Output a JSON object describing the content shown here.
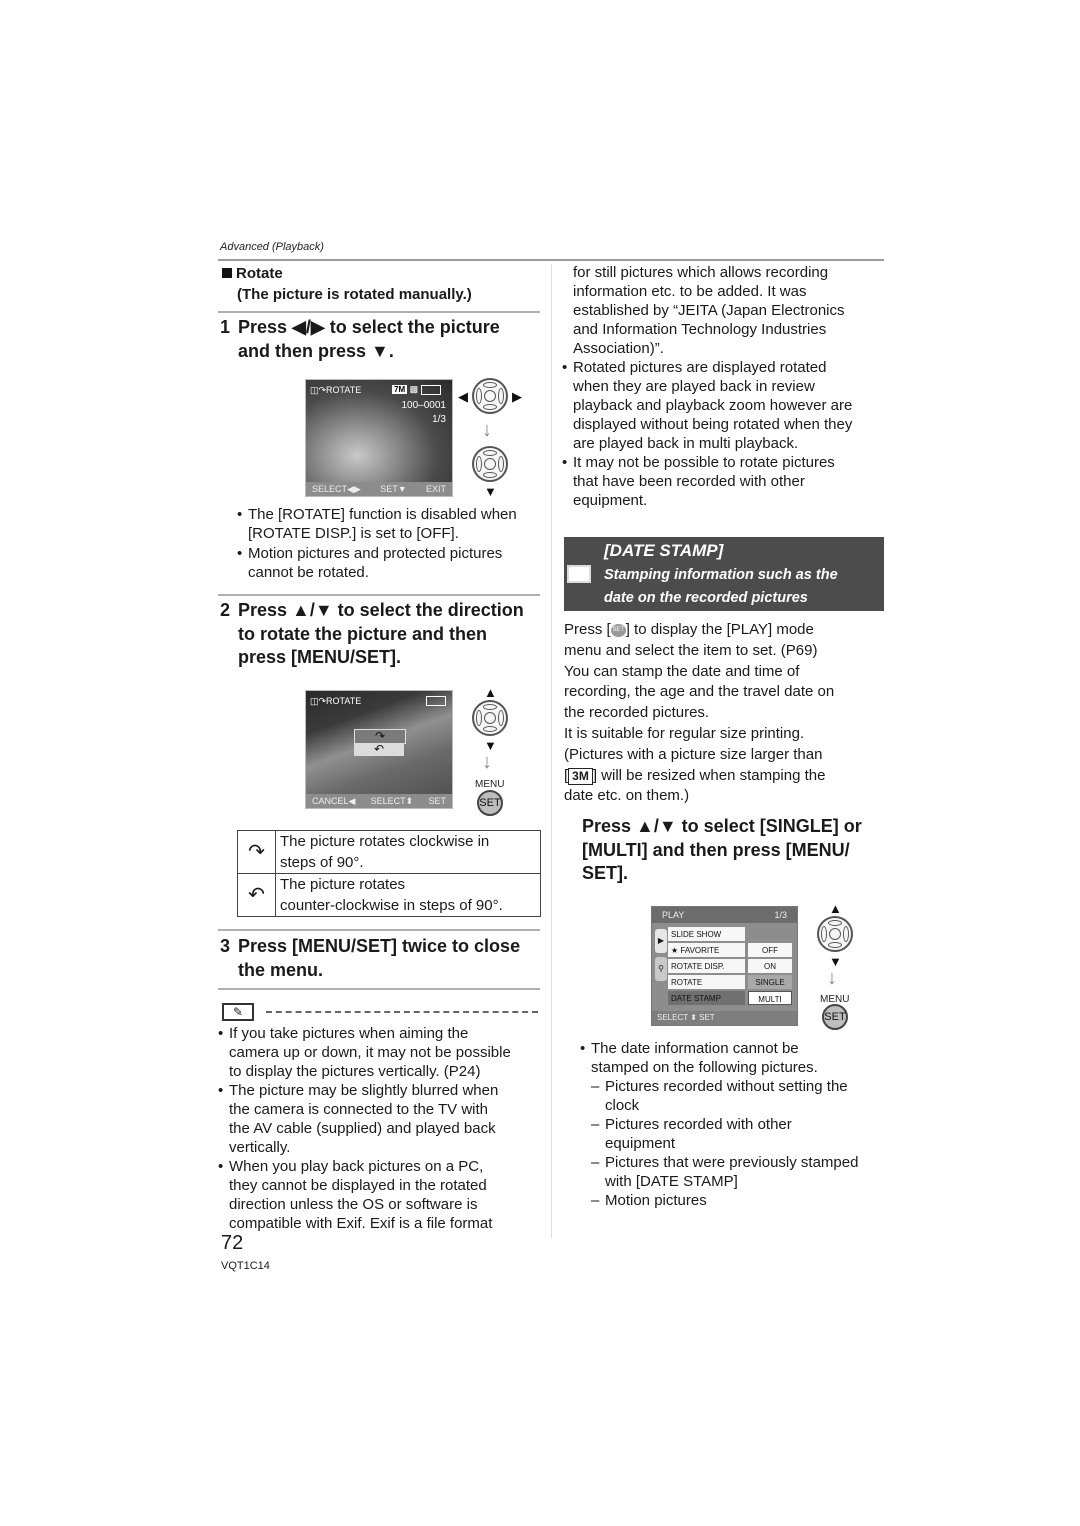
{
  "header": {
    "section_label": "Advanced (Playback)"
  },
  "left": {
    "rotate_title": "Rotate",
    "rotate_bullet_icon": "black-square",
    "rotate_subtitle": "(The picture is rotated manually.)",
    "step1": {
      "num": "1",
      "text_a": "Press ◀/▶ to select the picture",
      "text_b": "and then press ▼."
    },
    "screen1": {
      "mode_label": "ROTATE",
      "size_badge": "7M",
      "file_number": "100–0001",
      "counter": "1/3",
      "footer_select": "SELECT◀▶",
      "footer_set": "SET▼",
      "footer_exit": "EXIT"
    },
    "notes1": [
      "The [ROTATE] function is disabled when [ROTATE DISP.] is set to [OFF].",
      "Motion pictures and protected pictures cannot be rotated."
    ],
    "step2": {
      "num": "2",
      "text_a": "Press ▲/▼ to select the direction",
      "text_b": "to rotate the picture and then",
      "text_c": "press [MENU/SET]."
    },
    "screen2": {
      "mode_label": "ROTATE",
      "footer_cancel": "CANCEL◀",
      "footer_select": "SELECT⬍",
      "footer_set": "SET"
    },
    "controls": {
      "menu_label": "MENU",
      "set_label": "SET"
    },
    "rotate_table": [
      {
        "icon": "rotate-clockwise-icon",
        "glyph": "↷",
        "text_a": "The picture rotates clockwise in",
        "text_b": "steps of 90°."
      },
      {
        "icon": "rotate-counterclockwise-icon",
        "glyph": "↶",
        "text_a": "The picture rotates",
        "text_b": "counter-clockwise in steps of 90°."
      }
    ],
    "step3": {
      "num": "3",
      "text_a": "Press [MENU/SET] twice to close",
      "text_b": "the menu."
    },
    "notes2": [
      [
        "If you take pictures when aiming the",
        "camera up or down, it may not be possible",
        "to display the pictures vertically. (P24)"
      ],
      [
        "The picture may be slightly blurred when",
        "the camera is connected to the TV with",
        "the AV cable (supplied) and played back",
        "vertically."
      ],
      [
        "When you play back pictures on a PC,",
        "they cannot be displayed in the rotated",
        "direction unless the OS or software is",
        "compatible with Exif. Exif is a file format"
      ]
    ]
  },
  "right": {
    "continued": [
      "for still pictures which allows recording",
      "information etc. to be added. It was",
      "established by “JEITA (Japan Electronics",
      "and Information Technology Industries",
      "Association)”."
    ],
    "notes": [
      [
        "Rotated pictures are displayed rotated",
        "when they are played back in review",
        "playback and playback zoom however are",
        "displayed without being rotated when they",
        "are played back in multi playback."
      ],
      [
        "It may not be possible to rotate pictures",
        "that have been recorded with other",
        "equipment."
      ]
    ],
    "date_stamp": {
      "title": "[DATE STAMP]",
      "subtitle_a": "Stamping information such as the",
      "subtitle_b": "date on the recorded pictures"
    },
    "intro": {
      "line1_a": "Press [",
      "line1_b": "] to display the [PLAY] mode",
      "lines": [
        "menu and select the item to set. (P69)",
        "You can stamp the date and time of",
        "recording, the age and the travel date on",
        "the recorded pictures.",
        "It is suitable for regular size printing.",
        "(Pictures with a picture size larger than"
      ],
      "size_badge": "3M",
      "line_badge_after": "] will be resized when stamping the",
      "last_line": "date etc. on them.)"
    },
    "step": {
      "text_a": "Press ▲/▼ to select [SINGLE] or",
      "text_b": "[MULTI] and then press [MENU/",
      "text_c": "SET]."
    },
    "play_menu": {
      "title": "PLAY",
      "page": "1/3",
      "rows": [
        {
          "name": "SLIDE SHOW",
          "value": ""
        },
        {
          "name": "★ FAVORITE",
          "value": "OFF"
        },
        {
          "name": "ROTATE DISP.",
          "value": "ON"
        },
        {
          "name": "ROTATE",
          "value": "SINGLE"
        },
        {
          "name": "DATE STAMP",
          "value": "MULTI"
        }
      ],
      "footer": "SELECT ⬍  SET"
    },
    "bottom_note": [
      "The date information cannot be",
      "stamped on the following pictures."
    ],
    "dash_items": [
      [
        "Pictures recorded without setting the",
        "clock"
      ],
      [
        "Pictures recorded with other",
        "equipment"
      ],
      [
        "Pictures that were previously stamped",
        "with [DATE STAMP]"
      ],
      [
        "Motion pictures"
      ]
    ]
  },
  "footer": {
    "page_number": "72",
    "model_code": "VQT1C14"
  }
}
